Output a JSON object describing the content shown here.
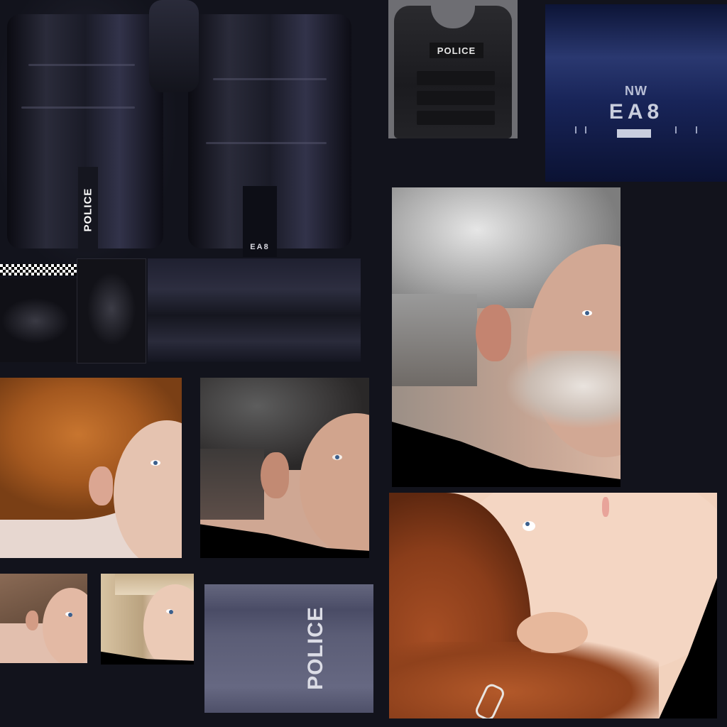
{
  "atlas": {
    "uniform": {
      "trouser_label": "POLICE",
      "trouser_id": "EA8"
    },
    "vest": {
      "label": "POLICE"
    },
    "plate": {
      "prefix": "NW",
      "code": "EA8"
    },
    "side_panel": {
      "label": "POLICE"
    }
  },
  "colors": {
    "background": "#12131c",
    "plate_blue": "#182458",
    "panel_grey": "#5b5d76",
    "hair_red": "#b05a22"
  }
}
